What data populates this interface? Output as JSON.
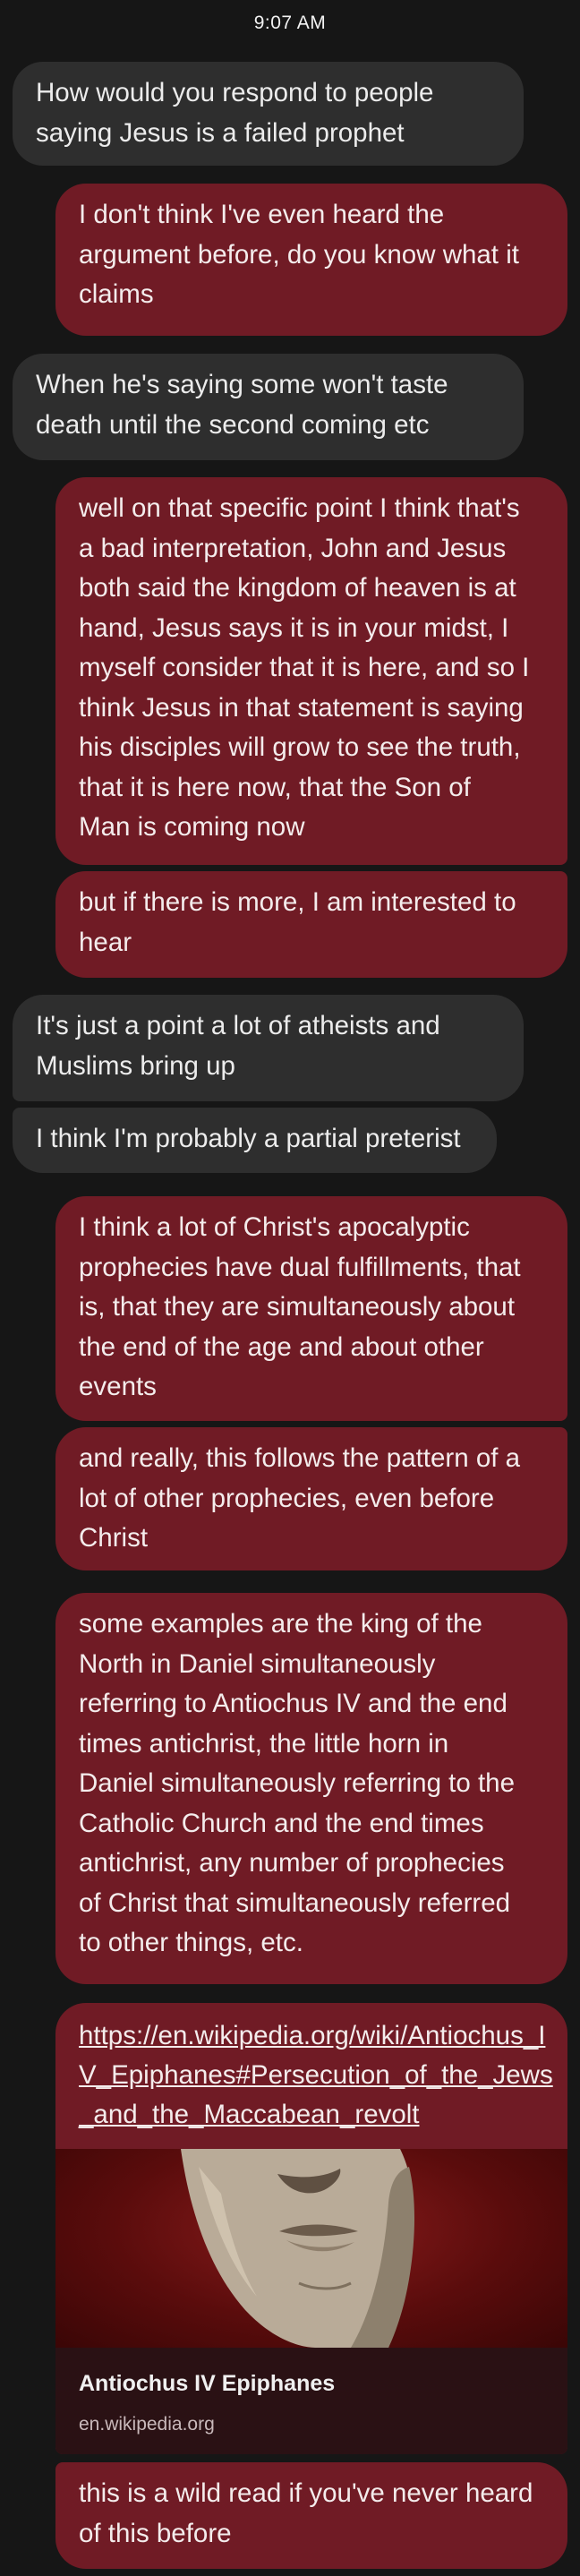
{
  "status_bar": {
    "time": "9:07 AM"
  },
  "messages": [
    {
      "direction": "incoming",
      "text": "How would you respond to people\nsaying Jesus is a failed prophet"
    },
    {
      "direction": "outgoing",
      "text": "I don't think I've even heard the\nargument before, do you know what it\nclaims"
    },
    {
      "direction": "incoming",
      "text": "When he's saying some won't taste\ndeath until the second coming etc"
    },
    {
      "direction": "outgoing",
      "text": "well on that specific point I think that's\na bad interpretation, John and Jesus\nboth said the kingdom of heaven is at\nhand, Jesus says it is in your midst, I\nmyself consider that it is here, and so I\nthink Jesus in that statement is saying\nhis disciples will grow to see the truth,\nthat it is here now, that the Son of\nMan is coming now"
    },
    {
      "direction": "outgoing",
      "text": "but if there is more, I am interested to\nhear"
    },
    {
      "direction": "incoming",
      "text": "It's just a point a lot of atheists and\nMuslims bring up"
    },
    {
      "direction": "incoming",
      "text": "I think I'm probably a partial preterist"
    },
    {
      "direction": "outgoing",
      "text": "I think a lot of Christ's apocalyptic\nprophecies have dual fulfillments, that\nis, that they are simultaneously about\nthe end of the age and about other\nevents"
    },
    {
      "direction": "outgoing",
      "text": "and really, this follows the pattern of a\nlot of other prophecies, even before\nChrist"
    },
    {
      "direction": "outgoing",
      "text": "some examples are the king of the\nNorth in Daniel simultaneously\nreferring to Antiochus IV and the end\ntimes antichrist, the little horn in\nDaniel simultaneously referring to the\nCatholic Church and the end times\nantichrist, any number of prophecies\nof Christ that simultaneously referred\nto other things, etc."
    },
    {
      "direction": "outgoing",
      "text": "this is a wild read if you've never heard\nof this before"
    }
  ],
  "link_preview": {
    "url": "https://en.wikipedia.org/wiki/Antiochus_IV_Epiphanes#Persecution_of_the_Jews_and_the_Maccabean_revolt",
    "title": "Antiochus IV Epiphanes",
    "domain": "en.wikipedia.org",
    "image_icon": "marble-bust-thumbnail"
  }
}
